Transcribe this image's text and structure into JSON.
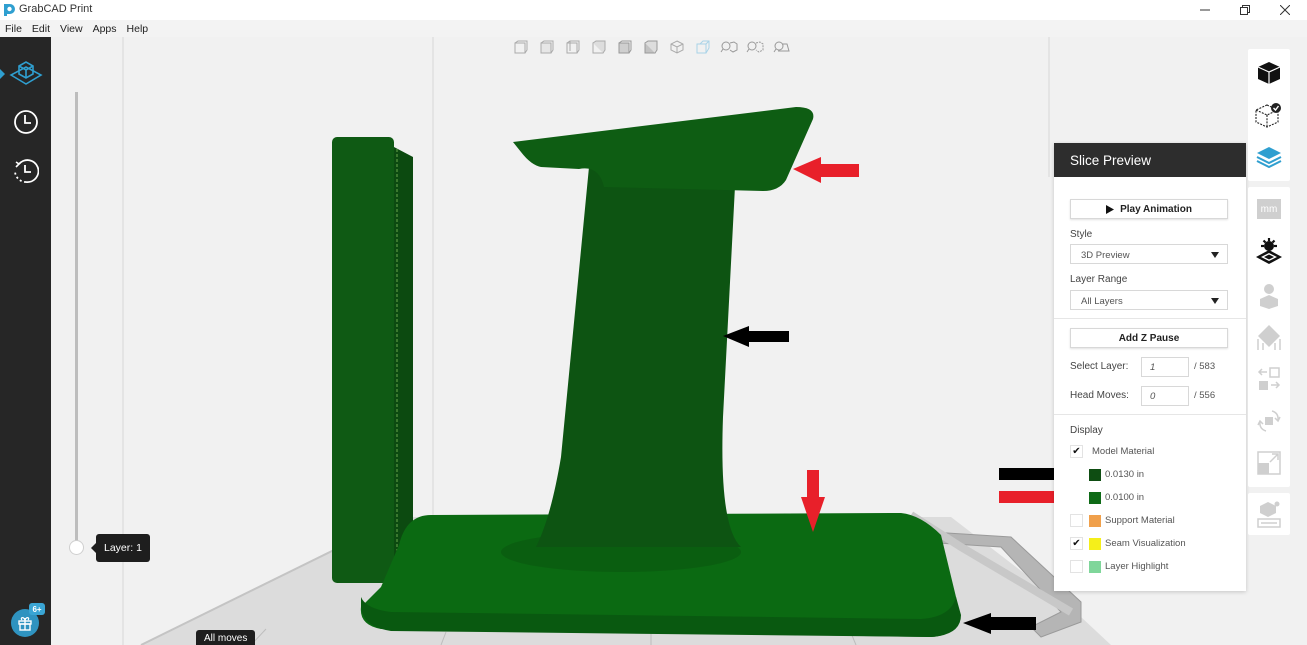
{
  "window": {
    "title": "GrabCAD Print",
    "controls": [
      "minimize",
      "maximize",
      "close"
    ]
  },
  "menu": [
    "File",
    "Edit",
    "View",
    "Apps",
    "Help"
  ],
  "left_nav": {
    "items": [
      {
        "name": "prepare",
        "icon": "box-on-plate-icon",
        "active": true
      },
      {
        "name": "schedule",
        "icon": "clock-icon",
        "active": false
      },
      {
        "name": "history",
        "icon": "history-clock-icon",
        "active": false
      }
    ],
    "gift_badge": "6+"
  },
  "view_toolbar": {
    "buttons": [
      "view-front",
      "view-back",
      "view-left",
      "view-right",
      "view-top",
      "view-bottom",
      "view-iso",
      "view-fit",
      "zoom-model",
      "zoom-selection",
      "zoom-plate"
    ]
  },
  "layer_slider": {
    "tooltip": "Layer: 1",
    "value": 1
  },
  "all_moves_tab": "All moves",
  "slice_preview": {
    "title": "Slice Preview",
    "play_animation": "Play Animation",
    "style_label": "Style",
    "style_value": "3D Preview",
    "layer_range_label": "Layer Range",
    "layer_range_value": "All Layers",
    "add_z_pause": "Add Z Pause",
    "select_layer_label": "Select Layer:",
    "select_layer_value": "1",
    "select_layer_total": "/ 583",
    "head_moves_label": "Head Moves:",
    "head_moves_value": "0",
    "head_moves_total": "/ 556",
    "display_label": "Display",
    "display_items": [
      {
        "label": "Model Material",
        "checked": true,
        "color": null
      },
      {
        "label": "0.0130 in",
        "checked": null,
        "color": "#0e4d12"
      },
      {
        "label": "0.0100 in",
        "checked": null,
        "color": "#0e6a16"
      },
      {
        "label": "Support Material",
        "checked": false,
        "color": "#f0a04b"
      },
      {
        "label": "Seam Visualization",
        "checked": true,
        "color": "#f5ef1a"
      },
      {
        "label": "Layer Highlight",
        "checked": false,
        "color": "#7fd69a"
      }
    ]
  },
  "right_toolbar": {
    "group1": [
      "add-model-icon",
      "check-model-icon",
      "slice-preview-icon"
    ],
    "group2": [
      "units-mm-icon",
      "settings-layer-icon",
      "model-settings-icon",
      "orient-icon",
      "arrange-icon",
      "rotate-icon",
      "scale-icon"
    ],
    "group3": [
      "tray-settings-icon"
    ],
    "units_text": "mm"
  },
  "colors": {
    "accent": "#2f9fd0",
    "model_dark": "#0e4d12",
    "model_light": "#0e6a16",
    "annotation_red": "#e8202a",
    "annotation_black": "#000000"
  }
}
